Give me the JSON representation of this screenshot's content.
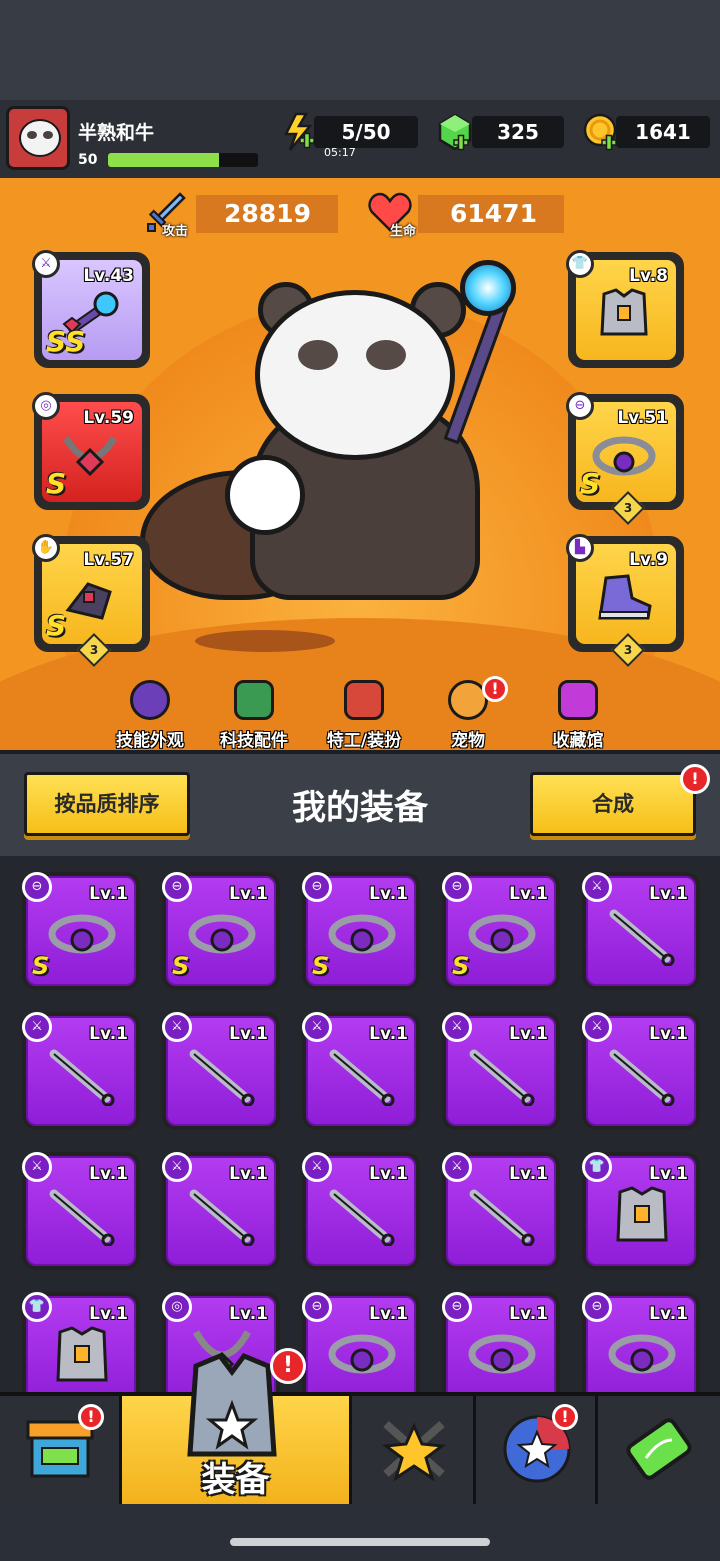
{
  "player": {
    "name": "半熟和牛",
    "level": "50",
    "xp_fraction": 0.74
  },
  "resources": {
    "energy": {
      "value": "5/50",
      "timer": "05:17"
    },
    "gems": {
      "value": "325"
    },
    "coins": {
      "value": "1641"
    }
  },
  "stats": {
    "attack": {
      "label": "攻击",
      "value": "28819"
    },
    "hp": {
      "label": "生命",
      "value": "61471"
    }
  },
  "equipped": {
    "weapon": {
      "level": "Lv.43",
      "grade": "SS"
    },
    "necklace": {
      "level": "Lv.59",
      "grade": "S"
    },
    "gloves": {
      "level": "Lv.57",
      "grade": "S",
      "stars": "3"
    },
    "armor": {
      "level": "Lv.8"
    },
    "belt": {
      "level": "Lv.51",
      "grade": "S",
      "stars": "3"
    },
    "boots": {
      "level": "Lv.9",
      "stars": "3"
    }
  },
  "hero_menu": [
    {
      "label": "技能外观"
    },
    {
      "label": "科技配件"
    },
    {
      "label": "特工/装扮"
    },
    {
      "label": "宠物",
      "badge": "!"
    },
    {
      "label": "收藏馆"
    }
  ],
  "panel": {
    "sort_button": "按品质排序",
    "title": "我的装备",
    "merge_button": "合成",
    "merge_badge": "!"
  },
  "inventory": [
    {
      "type": "belt",
      "level": "Lv.1",
      "grade": "S"
    },
    {
      "type": "belt",
      "level": "Lv.1",
      "grade": "S"
    },
    {
      "type": "belt",
      "level": "Lv.1",
      "grade": "S"
    },
    {
      "type": "belt",
      "level": "Lv.1",
      "grade": "S"
    },
    {
      "type": "weapon",
      "level": "Lv.1"
    },
    {
      "type": "weapon",
      "level": "Lv.1"
    },
    {
      "type": "weapon",
      "level": "Lv.1"
    },
    {
      "type": "weapon",
      "level": "Lv.1"
    },
    {
      "type": "weapon",
      "level": "Lv.1"
    },
    {
      "type": "weapon",
      "level": "Lv.1"
    },
    {
      "type": "weapon",
      "level": "Lv.1"
    },
    {
      "type": "weapon",
      "level": "Lv.1"
    },
    {
      "type": "weapon",
      "level": "Lv.1"
    },
    {
      "type": "weapon",
      "level": "Lv.1"
    },
    {
      "type": "armor",
      "level": "Lv.1"
    },
    {
      "type": "armor",
      "level": "Lv.1"
    },
    {
      "type": "necklace",
      "level": "Lv.1"
    },
    {
      "type": "belt",
      "level": "Lv.1"
    },
    {
      "type": "belt",
      "level": "Lv.1"
    },
    {
      "type": "belt",
      "level": "Lv.1"
    }
  ],
  "bottom_nav": {
    "active_label": "装备",
    "badge": "!"
  },
  "colors": {
    "accent": "#f39521",
    "item_epic": "#a62ee8",
    "button": "#ffd54a",
    "badge": "#e8262a"
  }
}
